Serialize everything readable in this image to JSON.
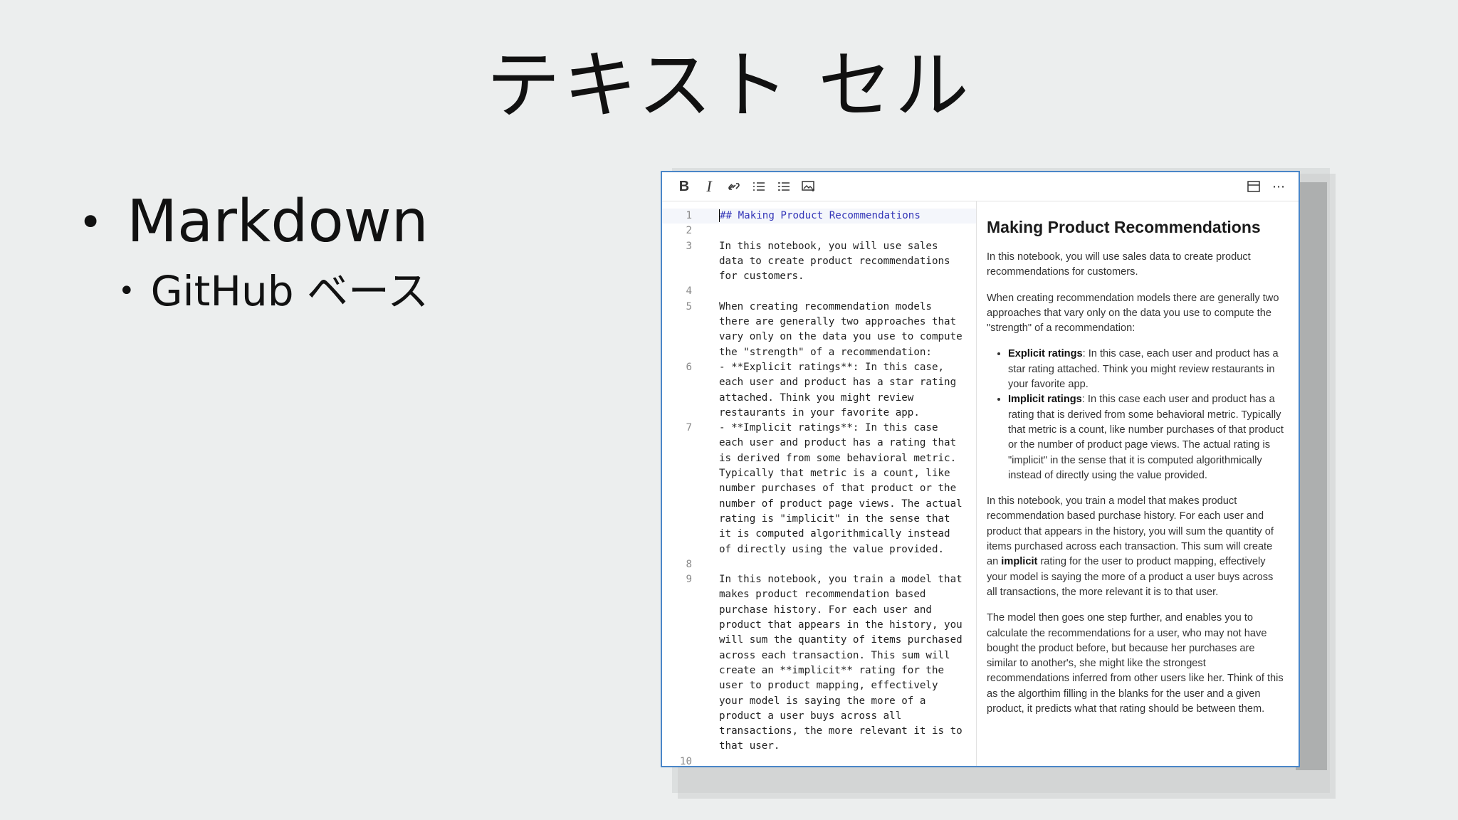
{
  "slide": {
    "title": "テキスト セル",
    "bullet1": "Markdown",
    "bullet2": "GitHub ベース",
    "bullet_char": "•"
  },
  "toolbar": {
    "bold": "B",
    "italic": "I",
    "link": "🔗",
    "list": "☰",
    "numbered": "≡",
    "image": "🖼",
    "layout": "▤",
    "more": "⋯"
  },
  "editor": {
    "lines": [
      {
        "num": "1",
        "text": "## Making Product Recommendations"
      },
      {
        "num": "2",
        "text": ""
      },
      {
        "num": "3",
        "text": "In this notebook, you will use sales"
      },
      {
        "num": "",
        "text": "data to create product recommendations"
      },
      {
        "num": "",
        "text": "for customers."
      },
      {
        "num": "4",
        "text": ""
      },
      {
        "num": "5",
        "text": "When creating recommendation models"
      },
      {
        "num": "",
        "text": "there are generally two approaches that"
      },
      {
        "num": "",
        "text": "vary only on the data you use to compute"
      },
      {
        "num": "",
        "text": "the \"strength\" of a recommendation:"
      },
      {
        "num": "6",
        "text": "- **Explicit ratings**: In this case,"
      },
      {
        "num": "",
        "text": "each user and product has a star rating"
      },
      {
        "num": "",
        "text": "attached. Think you might review"
      },
      {
        "num": "",
        "text": "restaurants in your favorite app."
      },
      {
        "num": "7",
        "text": "- **Implicit ratings**: In this case"
      },
      {
        "num": "",
        "text": "each user and product has a rating that"
      },
      {
        "num": "",
        "text": "is derived from some behavioral metric."
      },
      {
        "num": "",
        "text": "Typically that metric is a count, like"
      },
      {
        "num": "",
        "text": "number purchases of that product or the"
      },
      {
        "num": "",
        "text": "number of product page views. The actual"
      },
      {
        "num": "",
        "text": "rating is \"implicit\" in the sense that"
      },
      {
        "num": "",
        "text": "it is computed algorithmically instead"
      },
      {
        "num": "",
        "text": "of directly using the value provided."
      },
      {
        "num": "8",
        "text": ""
      },
      {
        "num": "9",
        "text": "In this notebook, you train a model that"
      },
      {
        "num": "",
        "text": "makes product recommendation based"
      },
      {
        "num": "",
        "text": "purchase history. For each user and"
      },
      {
        "num": "",
        "text": "product that appears in the history, you"
      },
      {
        "num": "",
        "text": "will sum the quantity of items purchased"
      },
      {
        "num": "",
        "text": "across each transaction. This sum will"
      },
      {
        "num": "",
        "text": "create an **implicit** rating for the"
      },
      {
        "num": "",
        "text": "user to product mapping, effectively"
      },
      {
        "num": "",
        "text": "your model is saying the more of a"
      },
      {
        "num": "",
        "text": "product a user buys across all"
      },
      {
        "num": "",
        "text": "transactions, the more relevant it is to"
      },
      {
        "num": "",
        "text": "that user."
      },
      {
        "num": "10",
        "text": ""
      }
    ]
  },
  "preview": {
    "heading": "Making Product Recommendations",
    "p1": "In this notebook, you will use sales data to create product recommendations for customers.",
    "p2": "When creating recommendation models there are generally two approaches that vary only on the data you use to compute the \"strength\" of a recommendation:",
    "li1_bold": "Explicit ratings",
    "li1_rest": ": In this case, each user and product has a star rating attached. Think you might review restaurants in your favorite app.",
    "li2_bold": "Implicit ratings",
    "li2_rest": ": In this case each user and product has a rating that is derived from some behavioral metric. Typically that metric is a count, like number purchases of that product or the number of product page views. The actual rating is \"implicit\" in the sense that it is computed algorithmically instead of directly using the value provided.",
    "p3_a": "In this notebook, you train a model that makes product recommendation based purchase history. For each user and product that appears in the history, you will sum the quantity of items purchased across each transaction. This sum will create an ",
    "p3_bold": "implicit",
    "p3_b": " rating for the user to product mapping, effectively your model is saying the more of a product a user buys across all transactions, the more relevant it is to that user.",
    "p4": "The model then goes one step further, and enables you to calculate the recommendations for a user, who may not have bought the product before, but because her purchases are similar to another's, she might like the strongest recommendations inferred from other users like her. Think of this as the algorthim filling in the blanks for the user and a given product, it predicts what that rating should be between them."
  }
}
